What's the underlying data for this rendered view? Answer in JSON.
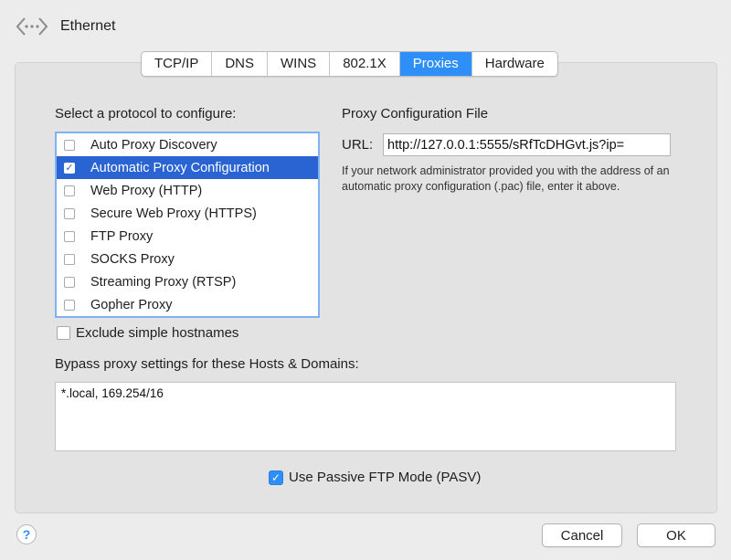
{
  "header": {
    "title": "Ethernet",
    "back_icon": "network-arrows-icon"
  },
  "tabs": [
    {
      "label": "TCP/IP",
      "active": false
    },
    {
      "label": "DNS",
      "active": false
    },
    {
      "label": "WINS",
      "active": false
    },
    {
      "label": "802.1X",
      "active": false
    },
    {
      "label": "Proxies",
      "active": true
    },
    {
      "label": "Hardware",
      "active": false
    }
  ],
  "protocols": {
    "heading": "Select a protocol to configure:",
    "items": [
      {
        "label": "Auto Proxy Discovery",
        "checked": false,
        "selected": false
      },
      {
        "label": "Automatic Proxy Configuration",
        "checked": true,
        "selected": true
      },
      {
        "label": "Web Proxy (HTTP)",
        "checked": false,
        "selected": false
      },
      {
        "label": "Secure Web Proxy (HTTPS)",
        "checked": false,
        "selected": false
      },
      {
        "label": "FTP Proxy",
        "checked": false,
        "selected": false
      },
      {
        "label": "SOCKS Proxy",
        "checked": false,
        "selected": false
      },
      {
        "label": "Streaming Proxy (RTSP)",
        "checked": false,
        "selected": false
      },
      {
        "label": "Gopher Proxy",
        "checked": false,
        "selected": false
      }
    ]
  },
  "config_file": {
    "heading": "Proxy Configuration File",
    "url_label": "URL:",
    "url_value": "http://127.0.0.1:5555/sRfTcDHGvt.js?ip=",
    "help_text": "If your network administrator provided you with the address of an automatic proxy configuration (.pac) file, enter it above."
  },
  "exclude_simple": {
    "label": "Exclude simple hostnames",
    "checked": false
  },
  "bypass": {
    "label": "Bypass proxy settings for these Hosts & Domains:",
    "value": "*.local, 169.254/16"
  },
  "passive_ftp": {
    "label": "Use Passive FTP Mode (PASV)",
    "checked": true
  },
  "footer": {
    "help_label": "?",
    "cancel_label": "Cancel",
    "ok_label": "OK"
  },
  "colors": {
    "accent": "#2f8ff8",
    "selection": "#2964d2",
    "panel": "#e3e3e3"
  }
}
